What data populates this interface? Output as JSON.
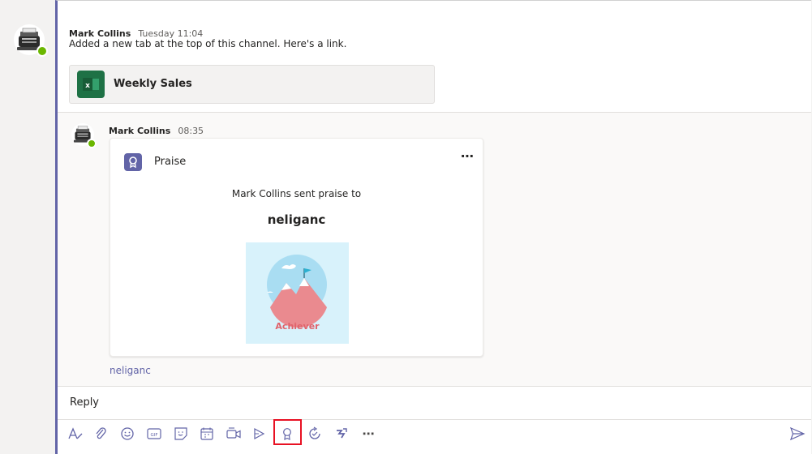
{
  "messages": [
    {
      "author": "Mark Collins",
      "time": "Tuesday 11:04",
      "text": "Added a new tab at the top of this channel. Here's a link.",
      "tab_card": {
        "title": "Weekly Sales",
        "app_icon": "excel-icon",
        "icon_letter": "x"
      }
    },
    {
      "author": "Mark Collins",
      "time": "08:35",
      "praise_card": {
        "header": "Praise",
        "sender_line": "Mark Collins sent praise to",
        "recipient": "neliganc",
        "badge_label": "Achiever",
        "more_icon": "ellipsis-icon"
      },
      "mention": "neliganc"
    }
  ],
  "reply": {
    "label": "Reply"
  },
  "toolbar": {
    "icons": [
      "format-icon",
      "attach-icon",
      "emoji-icon",
      "gif-icon",
      "sticker-icon",
      "schedule-meeting-icon",
      "meet-now-icon",
      "stream-icon",
      "praise-icon",
      "updates-icon",
      "flow-icon",
      "more-options-icon"
    ],
    "gif_label": "GIF",
    "send_icon": "send-icon",
    "highlighted": "praise-icon"
  },
  "colors": {
    "accent": "#6264a7",
    "presence": "#6bb700",
    "excel": "#1e7145",
    "highlight": "#e81123",
    "badge_background": "#d8f2fb",
    "badge_text": "#e0636b"
  }
}
